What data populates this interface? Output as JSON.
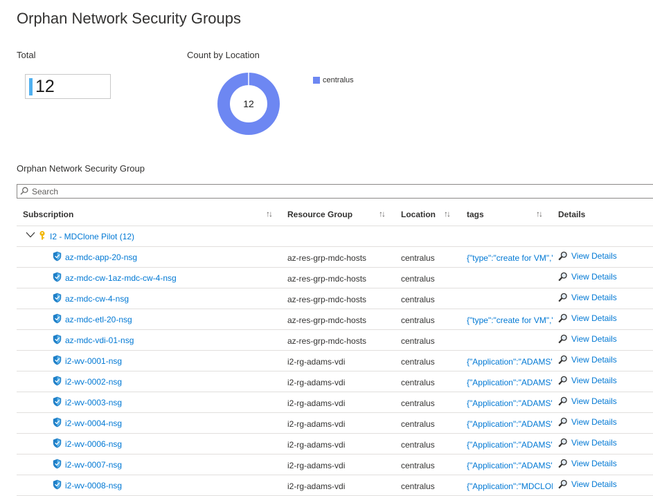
{
  "page": {
    "title": "Orphan Network Security Groups"
  },
  "total": {
    "label": "Total",
    "value": "12",
    "accent": "#50b0f0"
  },
  "count_by_location": {
    "label": "Count by Location",
    "center_value": "12",
    "legend": [
      {
        "label": "centralus",
        "color": "#6d87f2"
      }
    ],
    "chart_data": {
      "type": "pie",
      "title": "Count by Location",
      "categories": [
        "centralus"
      ],
      "values": [
        12
      ],
      "legend_placement": "right"
    }
  },
  "table": {
    "title": "Orphan Network Security Group",
    "search_placeholder": "Search",
    "columns": {
      "subscription": "Subscription",
      "resource_group": "Resource Group",
      "location": "Location",
      "tags": "tags",
      "details": "Details"
    },
    "sort_glyph": "↑↓",
    "group": {
      "label": "I2 - MDClone Pilot (12)",
      "icon": "key-icon",
      "expanded": true
    },
    "rows": [
      {
        "name": "az-mdc-app-20-nsg",
        "resource_group": "az-res-grp-mdc-hosts",
        "location": "centralus",
        "tags": "{\"type\":\"create for VM\",\"",
        "details": "View Details"
      },
      {
        "name": "az-mdc-cw-1az-mdc-cw-4-nsg",
        "resource_group": "az-res-grp-mdc-hosts",
        "location": "centralus",
        "tags": "",
        "details": "View Details"
      },
      {
        "name": "az-mdc-cw-4-nsg",
        "resource_group": "az-res-grp-mdc-hosts",
        "location": "centralus",
        "tags": "",
        "details": "View Details"
      },
      {
        "name": "az-mdc-etl-20-nsg",
        "resource_group": "az-res-grp-mdc-hosts",
        "location": "centralus",
        "tags": "{\"type\":\"create for VM\",\"",
        "details": "View Details"
      },
      {
        "name": "az-mdc-vdi-01-nsg",
        "resource_group": "az-res-grp-mdc-hosts",
        "location": "centralus",
        "tags": "",
        "details": "View Details"
      },
      {
        "name": "i2-wv-0001-nsg",
        "resource_group": "i2-rg-adams-vdi",
        "location": "centralus",
        "tags": "{\"Application\":\"ADAMS\"",
        "details": "View Details"
      },
      {
        "name": "i2-wv-0002-nsg",
        "resource_group": "i2-rg-adams-vdi",
        "location": "centralus",
        "tags": "{\"Application\":\"ADAMS\"",
        "details": "View Details"
      },
      {
        "name": "i2-wv-0003-nsg",
        "resource_group": "i2-rg-adams-vdi",
        "location": "centralus",
        "tags": "{\"Application\":\"ADAMS\"",
        "details": "View Details"
      },
      {
        "name": "i2-wv-0004-nsg",
        "resource_group": "i2-rg-adams-vdi",
        "location": "centralus",
        "tags": "{\"Application\":\"ADAMS\"",
        "details": "View Details"
      },
      {
        "name": "i2-wv-0006-nsg",
        "resource_group": "i2-rg-adams-vdi",
        "location": "centralus",
        "tags": "{\"Application\":\"ADAMS\"",
        "details": "View Details"
      },
      {
        "name": "i2-wv-0007-nsg",
        "resource_group": "i2-rg-adams-vdi",
        "location": "centralus",
        "tags": "{\"Application\":\"ADAMS\"",
        "details": "View Details"
      },
      {
        "name": "i2-wv-0008-nsg",
        "resource_group": "i2-rg-adams-vdi",
        "location": "centralus",
        "tags": "{\"Application\":\"MDCLON",
        "details": "View Details"
      }
    ]
  },
  "colors": {
    "link": "#0078d4",
    "donut": "#6d87f2",
    "text": "#323130",
    "border": "#e1dfdd"
  }
}
